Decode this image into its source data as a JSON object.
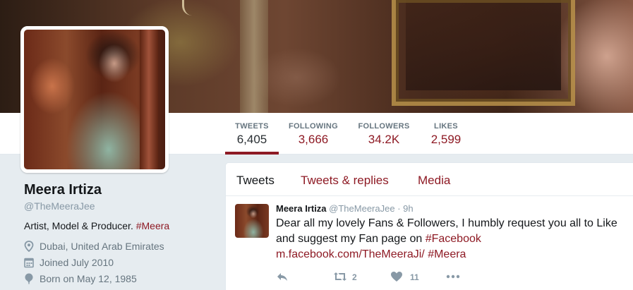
{
  "nav": {
    "items": [
      {
        "label": "TWEETS",
        "value": "6,405",
        "active": true
      },
      {
        "label": "FOLLOWING",
        "value": "3,666"
      },
      {
        "label": "FOLLOWERS",
        "value": "34.2K"
      },
      {
        "label": "LIKES",
        "value": "2,599"
      }
    ]
  },
  "profile": {
    "name": "Meera Irtiza",
    "handle": "@TheMeeraJee",
    "bio_text": "Artist, Model & Producer.",
    "bio_hashtag": "#Meera",
    "location": "Dubai, United Arab Emirates",
    "joined": "Joined July 2010",
    "born": "Born on May 12, 1985",
    "location_icon": "location-pin-icon",
    "joined_icon": "calendar-icon",
    "born_icon": "balloon-icon"
  },
  "timeline": {
    "tabs": [
      {
        "label": "Tweets",
        "active": true
      },
      {
        "label": "Tweets & replies"
      },
      {
        "label": "Media"
      }
    ]
  },
  "tweet": {
    "name": "Meera Irtiza",
    "handle": "@TheMeeraJee",
    "separator": "·",
    "time": "9h",
    "text_1": "Dear all my lovely Fans & Followers, I humbly request you all to Like and suggest my Fan page on",
    "hashtag_1": "#Facebook",
    "link": "m.facebook.com/TheMeeraJi/",
    "hashtag_2": "#Meera",
    "retweets": "2",
    "likes": "11"
  },
  "colors": {
    "accent": "#8e1a24",
    "muted": "#8899a6",
    "background": "#e6ecf0"
  }
}
